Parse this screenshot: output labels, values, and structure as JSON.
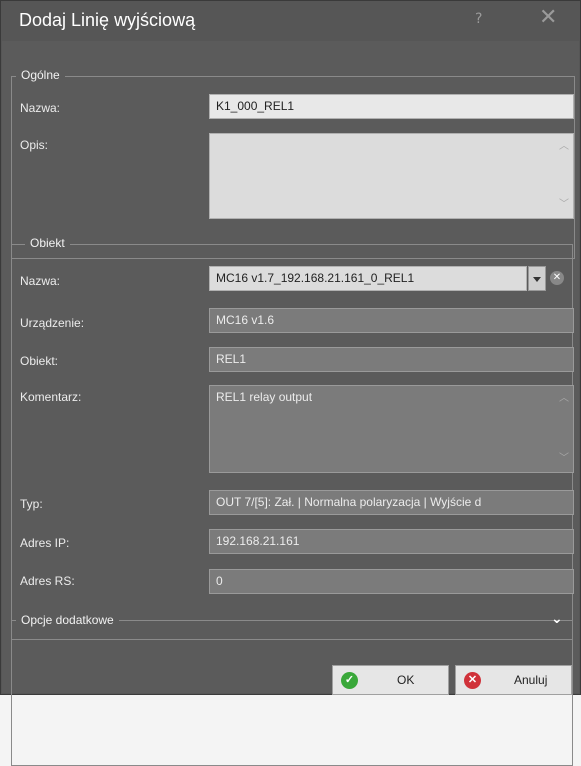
{
  "window": {
    "title": "Dodaj Linię wyjściową",
    "help_glyph": "?",
    "close_glyph": "✕"
  },
  "general": {
    "legend": "Ogólne",
    "name_label": "Nazwa:",
    "name_value": "K1_000_REL1",
    "desc_label": "Opis:",
    "desc_value": ""
  },
  "object": {
    "legend": "Obiekt",
    "name_label": "Nazwa:",
    "name_value": "MC16 v1.7_192.168.21.161_0_REL1",
    "device_label": "Urządzenie:",
    "device_value": "MC16 v1.6",
    "object_label": "Obiekt:",
    "object_value": "REL1",
    "comment_label": "Komentarz:",
    "comment_value": "REL1 relay output",
    "type_label": "Typ:",
    "type_value": "OUT 7/[5]: Zał. | Normalna polaryzacja | Wyjście d",
    "ip_label": "Adres IP:",
    "ip_value": "192.168.21.161",
    "rs_label": "Adres RS:",
    "rs_value": "0"
  },
  "extra": {
    "legend": "Opcje dodatkowe"
  },
  "buttons": {
    "ok_label": "OK",
    "cancel_label": "Anuluj"
  },
  "colors": {
    "ok_icon": "#3aa83a",
    "cancel_icon": "#d0323a"
  }
}
